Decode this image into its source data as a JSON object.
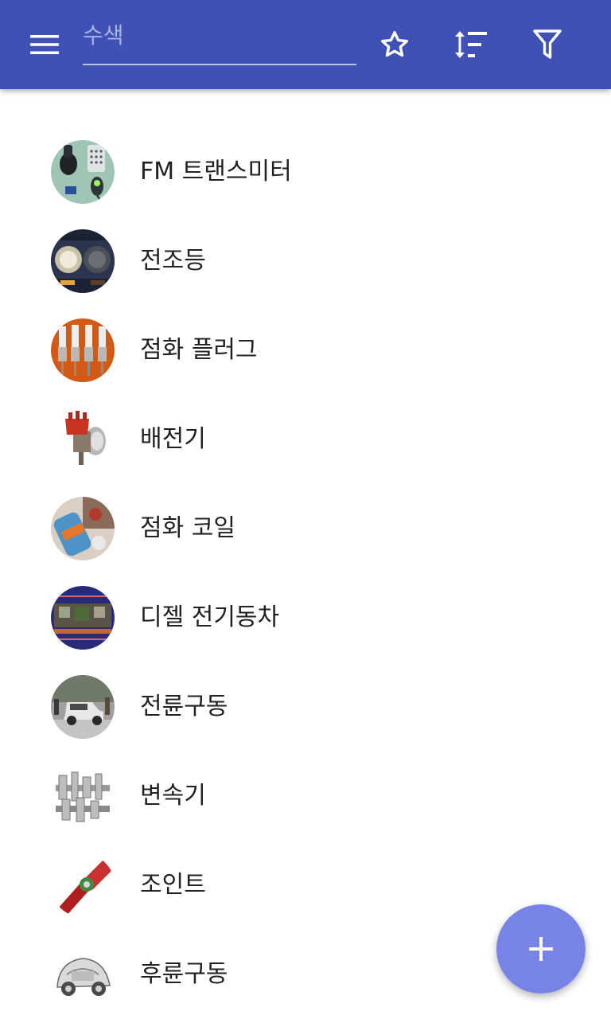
{
  "toolbar": {
    "menu_icon": "hamburger-menu-icon",
    "search_placeholder": "수색",
    "search_value": "",
    "favorite_icon": "star-outline-icon",
    "sort_icon": "sort-icon",
    "filter_icon": "filter-icon",
    "background_color": "#3f51b5"
  },
  "items": [
    {
      "label": "FM 트랜스미터"
    },
    {
      "label": "전조등"
    },
    {
      "label": "점화 플러그"
    },
    {
      "label": "배전기"
    },
    {
      "label": "점화 코일"
    },
    {
      "label": "디젤 전기동차"
    },
    {
      "label": "전륜구동"
    },
    {
      "label": "변속기"
    },
    {
      "label": "조인트"
    },
    {
      "label": "후륜구동"
    }
  ],
  "fab": {
    "icon": "plus-icon",
    "color": "#7883e6"
  }
}
